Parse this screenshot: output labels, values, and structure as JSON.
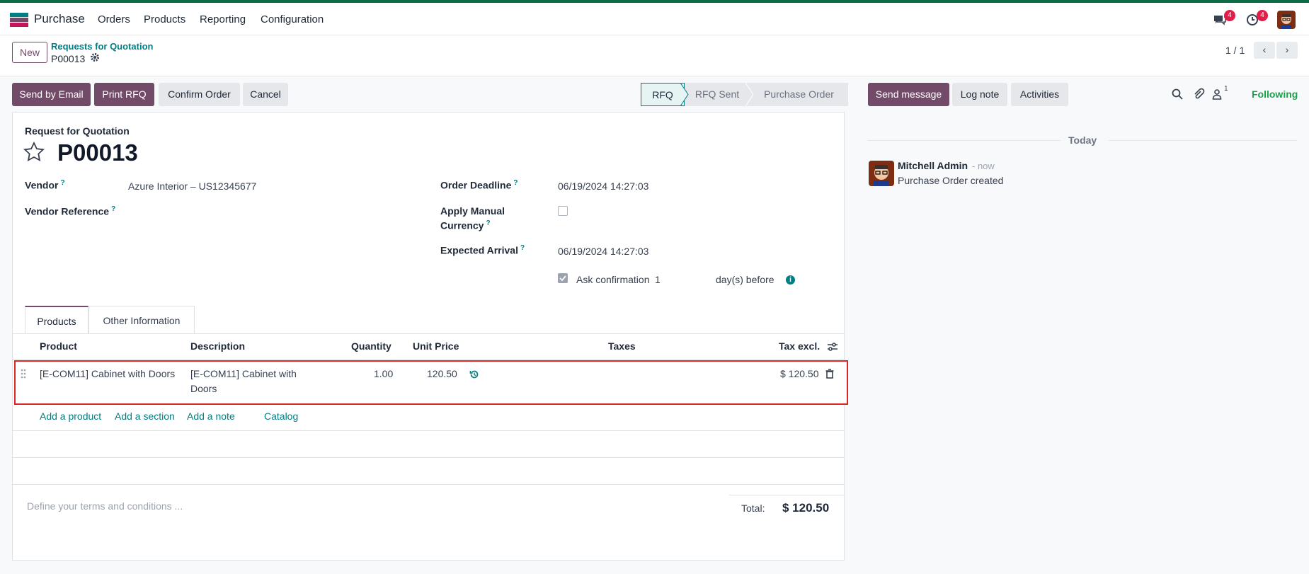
{
  "app": {
    "name": "Purchase",
    "menu": [
      "Orders",
      "Products",
      "Reporting",
      "Configuration"
    ],
    "messages_badge": "4",
    "activities_badge": "4"
  },
  "control": {
    "new_label": "New",
    "breadcrumb": "Requests for Quotation",
    "record": "P00013",
    "pager": "1 / 1"
  },
  "actions": {
    "send_email": "Send by Email",
    "print_rfq": "Print RFQ",
    "confirm": "Confirm Order",
    "cancel": "Cancel"
  },
  "status": {
    "stages": [
      "RFQ",
      "RFQ Sent",
      "Purchase Order"
    ],
    "active": "RFQ"
  },
  "form": {
    "title_label": "Request for Quotation",
    "title": "P00013",
    "vendor_label": "Vendor",
    "vendor_value": "Azure Interior – US12345677",
    "vendor_ref_label": "Vendor Reference",
    "order_deadline_label": "Order Deadline",
    "order_deadline_value": "06/19/2024 14:27:03",
    "manual_currency_label_1": "Apply Manual",
    "manual_currency_label_2": "Currency",
    "expected_arrival_label": "Expected Arrival",
    "expected_arrival_value": "06/19/2024 14:27:03",
    "ask_confirmation_label": "Ask confirmation",
    "ask_confirmation_days": "1",
    "days_before": "day(s) before"
  },
  "tabs": {
    "products": "Products",
    "other": "Other Information"
  },
  "table": {
    "headers": {
      "product": "Product",
      "description": "Description",
      "quantity": "Quantity",
      "unit_price": "Unit Price",
      "taxes": "Taxes",
      "tax_excl": "Tax excl."
    },
    "rows": [
      {
        "product": "[E-COM11] Cabinet with Doors",
        "description_1": "[E-COM11] Cabinet with",
        "description_2": "Doors",
        "quantity": "1.00",
        "unit_price": "120.50",
        "subtotal": "$ 120.50"
      }
    ],
    "add_product": "Add a product",
    "add_section": "Add a section",
    "add_note": "Add a note",
    "catalog": "Catalog"
  },
  "footer": {
    "terms_placeholder": "Define your terms and conditions ...",
    "total_label": "Total:",
    "total_value": "$ 120.50"
  },
  "chatter": {
    "send_message": "Send message",
    "log_note": "Log note",
    "activities": "Activities",
    "followers_count": "1",
    "following": "Following",
    "today": "Today",
    "author": "Mitchell Admin",
    "time": "- now",
    "body": "Purchase Order created"
  },
  "colors": {
    "brand": "#714b67",
    "link": "#017e84",
    "accent_bar": "#0b6b47",
    "selected_outline": "#dc2626"
  }
}
